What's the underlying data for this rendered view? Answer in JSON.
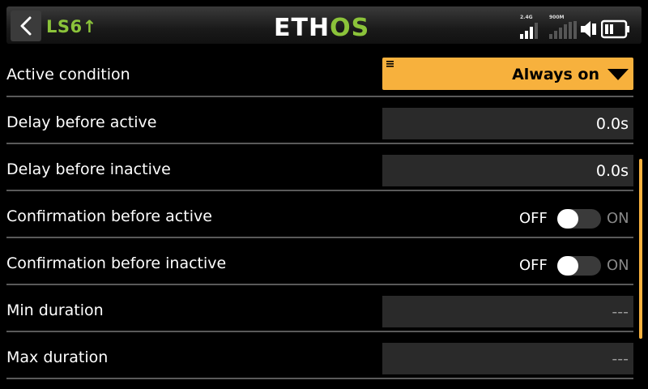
{
  "header": {
    "title": "LS6↑",
    "logo_text": "ETHOS",
    "status": {
      "rf_24_label": "2.4G",
      "rf_900_label": "900M",
      "rf_24_level": 3,
      "rf_900_level": 0,
      "icons": [
        "speaker-icon",
        "battery-icon"
      ]
    }
  },
  "colors": {
    "accent": "#f7b13d",
    "title_green": "#8bc33a",
    "field_bg": "#2a2a2a",
    "divider": "#5a5a5a"
  },
  "rows": [
    {
      "label": "Active condition",
      "type": "dropdown",
      "value": "Always on"
    },
    {
      "label": "Delay before active",
      "type": "value",
      "value": "0.0s"
    },
    {
      "label": "Delay before inactive",
      "type": "value",
      "value": "0.0s"
    },
    {
      "label": "Confirmation before active",
      "type": "toggle",
      "off_label": "OFF",
      "on_label": "ON",
      "state": "off"
    },
    {
      "label": "Confirmation before inactive",
      "type": "toggle",
      "off_label": "OFF",
      "on_label": "ON",
      "state": "off"
    },
    {
      "label": "Min duration",
      "type": "value",
      "value": "---"
    },
    {
      "label": "Max duration",
      "type": "value",
      "value": "---"
    }
  ]
}
